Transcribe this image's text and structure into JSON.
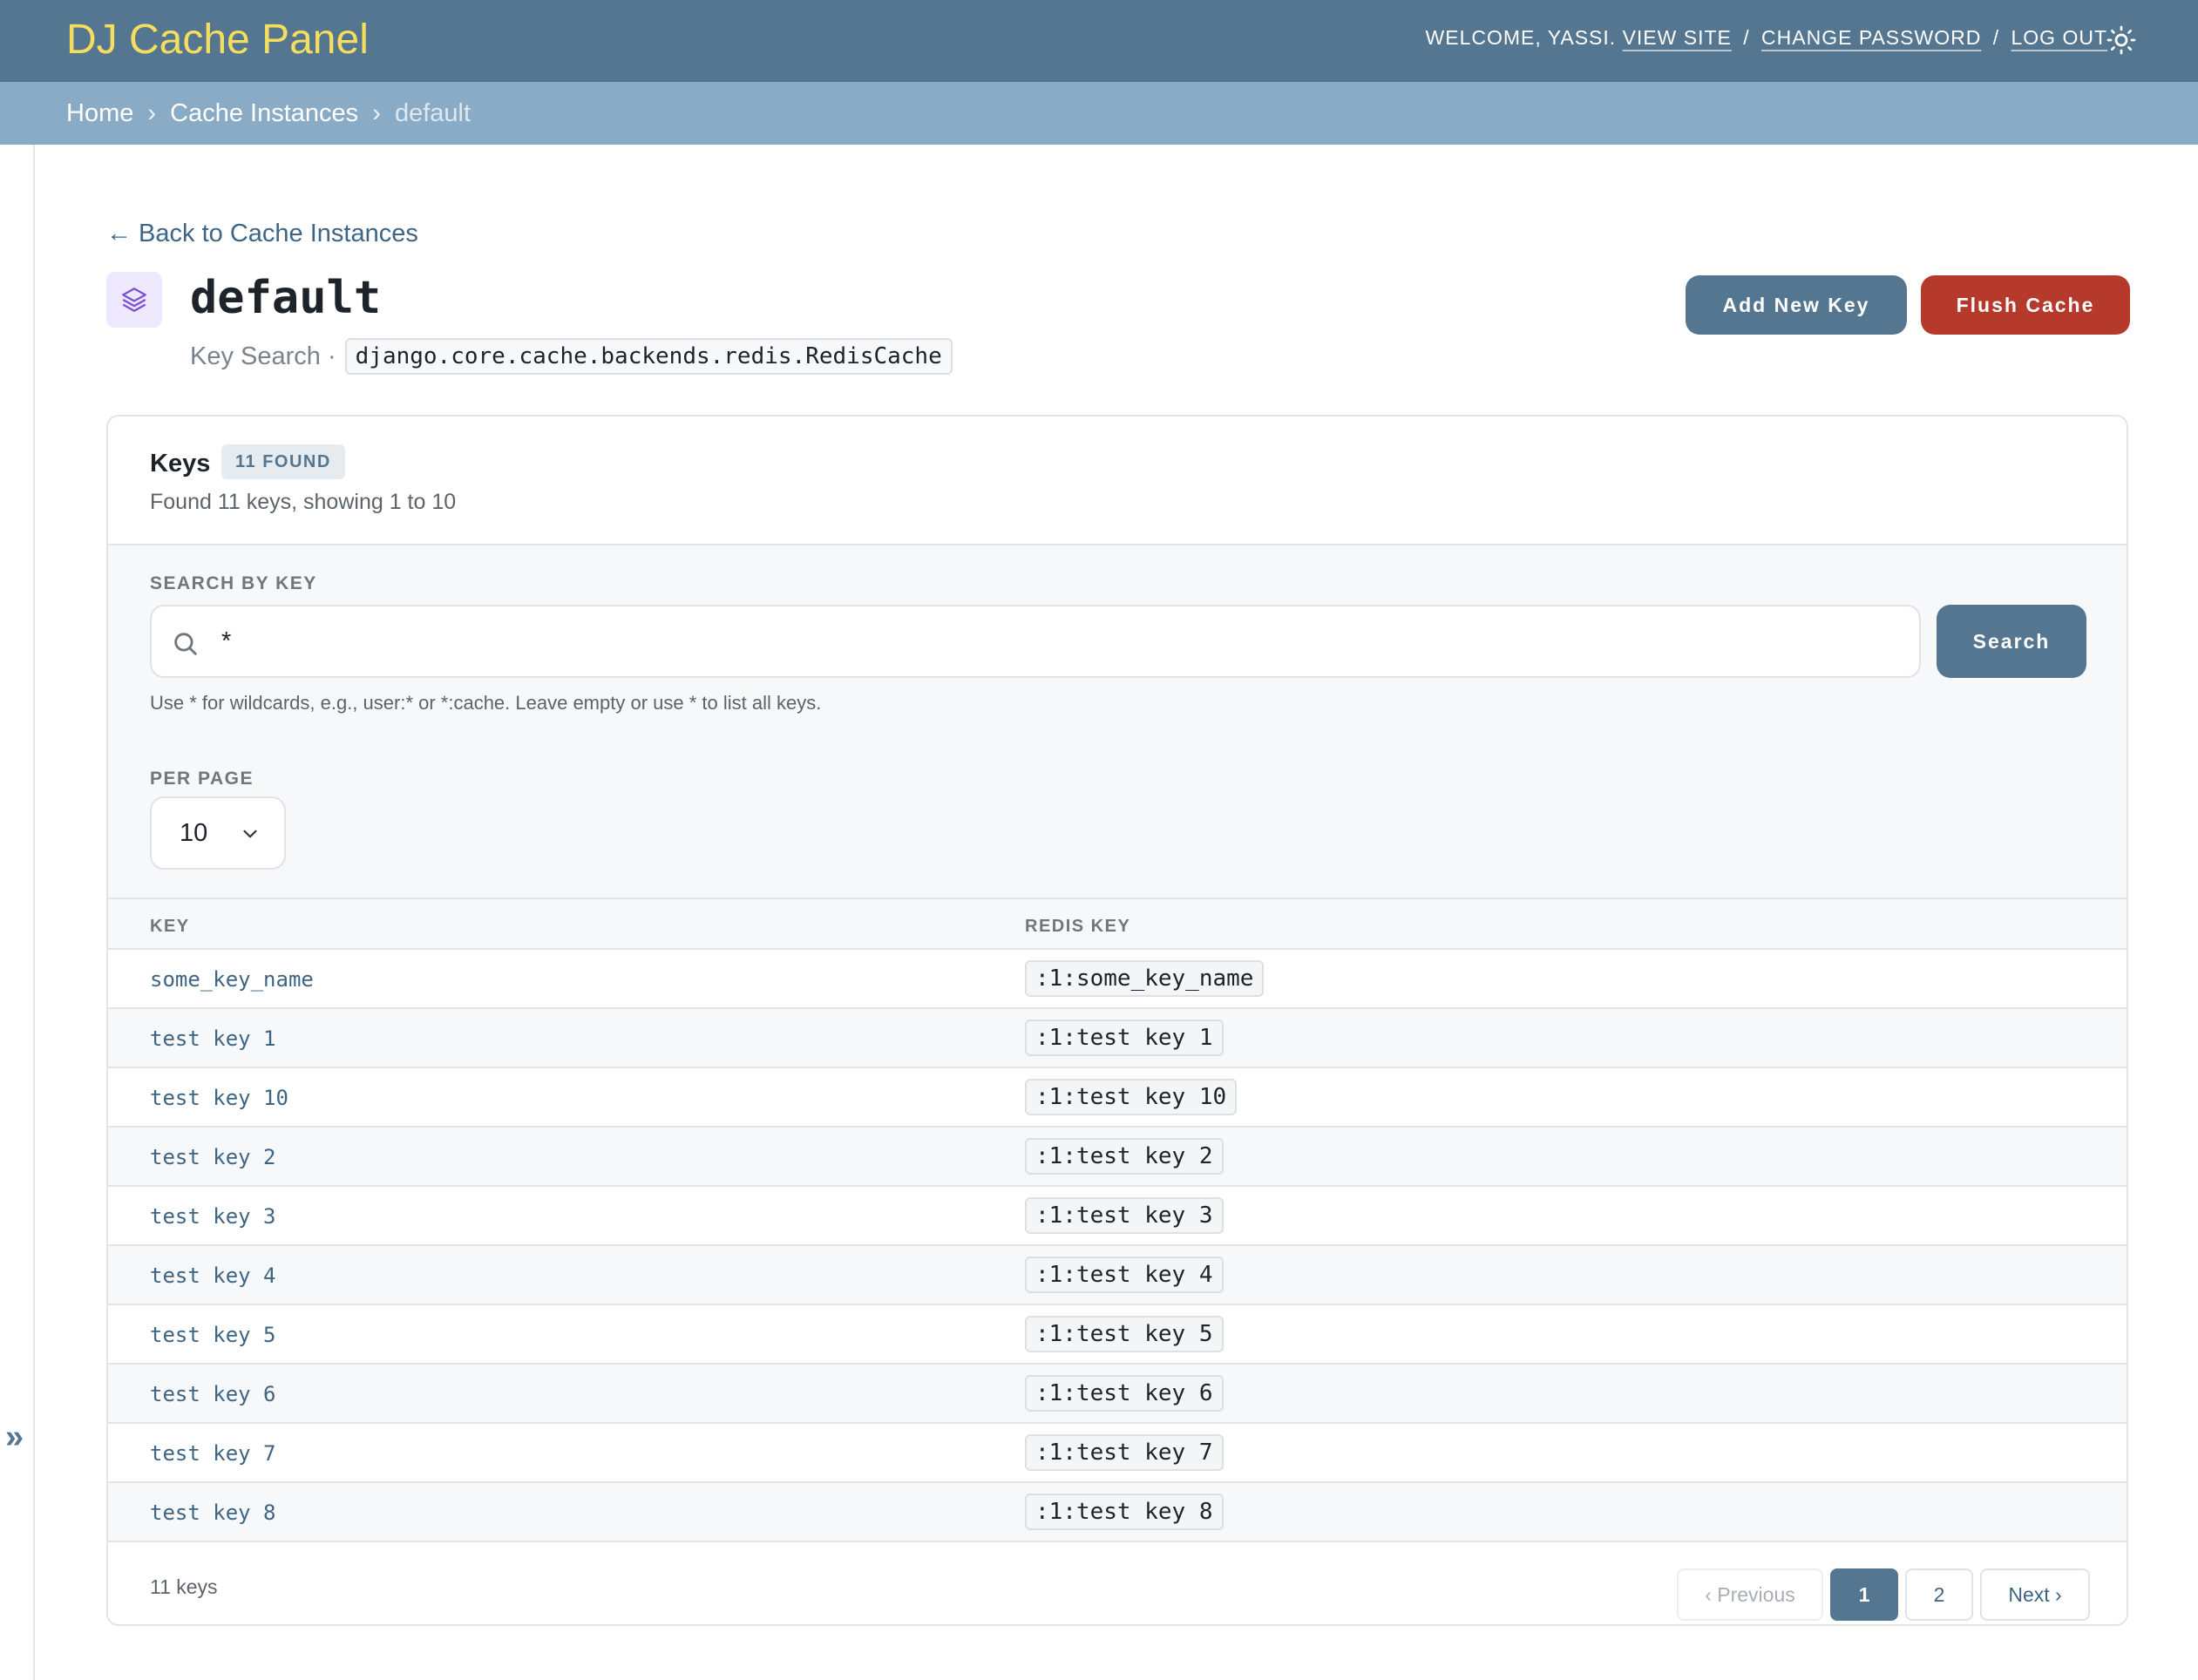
{
  "header": {
    "brand": "DJ Cache Panel",
    "welcome": "WELCOME, YASSI.",
    "view_site": "VIEW SITE",
    "change_password": "CHANGE PASSWORD",
    "log_out": "LOG OUT",
    "separator": "/",
    "theme_icon": "sun-icon"
  },
  "breadcrumbs": {
    "home": "Home",
    "instances": "Cache Instances",
    "current": "default",
    "arrow": "›"
  },
  "sidebar": {
    "toggle": "»"
  },
  "page": {
    "back_link": "← Back to Cache Instances",
    "title": "default",
    "subtitle": "Key Search ·",
    "backend": "django.core.cache.backends.redis.RedisCache",
    "add_button": "Add New Key",
    "flush_button": "Flush Cache"
  },
  "keys_card": {
    "title": "Keys",
    "badge": "11 FOUND",
    "found_text": "Found 11 keys, showing 1 to 10",
    "search_label": "SEARCH BY KEY",
    "search_value": "*",
    "search_button": "Search",
    "help_text": "Use * for wildcards, e.g., user:* or *:cache. Leave empty or use * to list all keys.",
    "per_page_label": "PER PAGE",
    "per_page_value": "10",
    "columns": [
      "KEY",
      "REDIS KEY"
    ],
    "rows": [
      {
        "key": "some_key_name",
        "redis_key": ":1:some_key_name"
      },
      {
        "key": "test key 1",
        "redis_key": ":1:test key 1"
      },
      {
        "key": "test key 10",
        "redis_key": ":1:test key 10"
      },
      {
        "key": "test key 2",
        "redis_key": ":1:test key 2"
      },
      {
        "key": "test key 3",
        "redis_key": ":1:test key 3"
      },
      {
        "key": "test key 4",
        "redis_key": ":1:test key 4"
      },
      {
        "key": "test key 5",
        "redis_key": ":1:test key 5"
      },
      {
        "key": "test key 6",
        "redis_key": ":1:test key 6"
      },
      {
        "key": "test key 7",
        "redis_key": ":1:test key 7"
      },
      {
        "key": "test key 8",
        "redis_key": ":1:test key 8"
      }
    ],
    "total": "11 keys",
    "pagination": {
      "previous": "‹ Previous",
      "pages": [
        "1",
        "2"
      ],
      "current_page": "1",
      "next": "Next ›"
    }
  },
  "colors": {
    "header_bg": "#557690",
    "brand": "#f5dd5d",
    "breadcrumb_bg": "#8aabc6",
    "primary": "#557690",
    "danger": "#b53a2c",
    "link": "#3f6585"
  }
}
